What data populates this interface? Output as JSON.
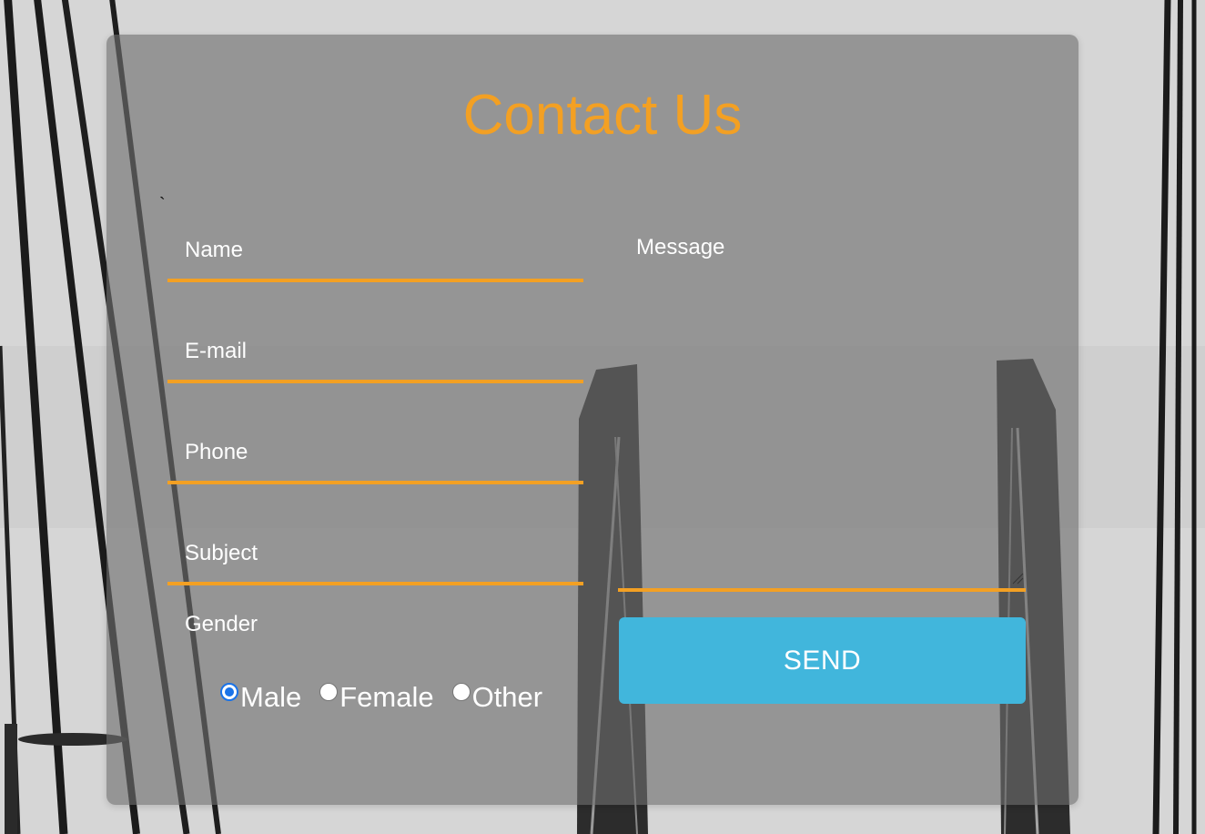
{
  "form": {
    "title": "Contact Us",
    "stray_char": "`",
    "fields": {
      "name_placeholder": "Name",
      "email_placeholder": "E-mail",
      "phone_placeholder": "Phone",
      "subject_placeholder": "Subject",
      "message_placeholder": "Message"
    },
    "gender": {
      "label": "Gender",
      "options": [
        "Male",
        "Female",
        "Other"
      ],
      "selected": "Male"
    },
    "send_label": "SEND"
  },
  "colors": {
    "accent": "#f3a023",
    "button": "#41b6dc",
    "radio_selected": "#1a73e8"
  }
}
